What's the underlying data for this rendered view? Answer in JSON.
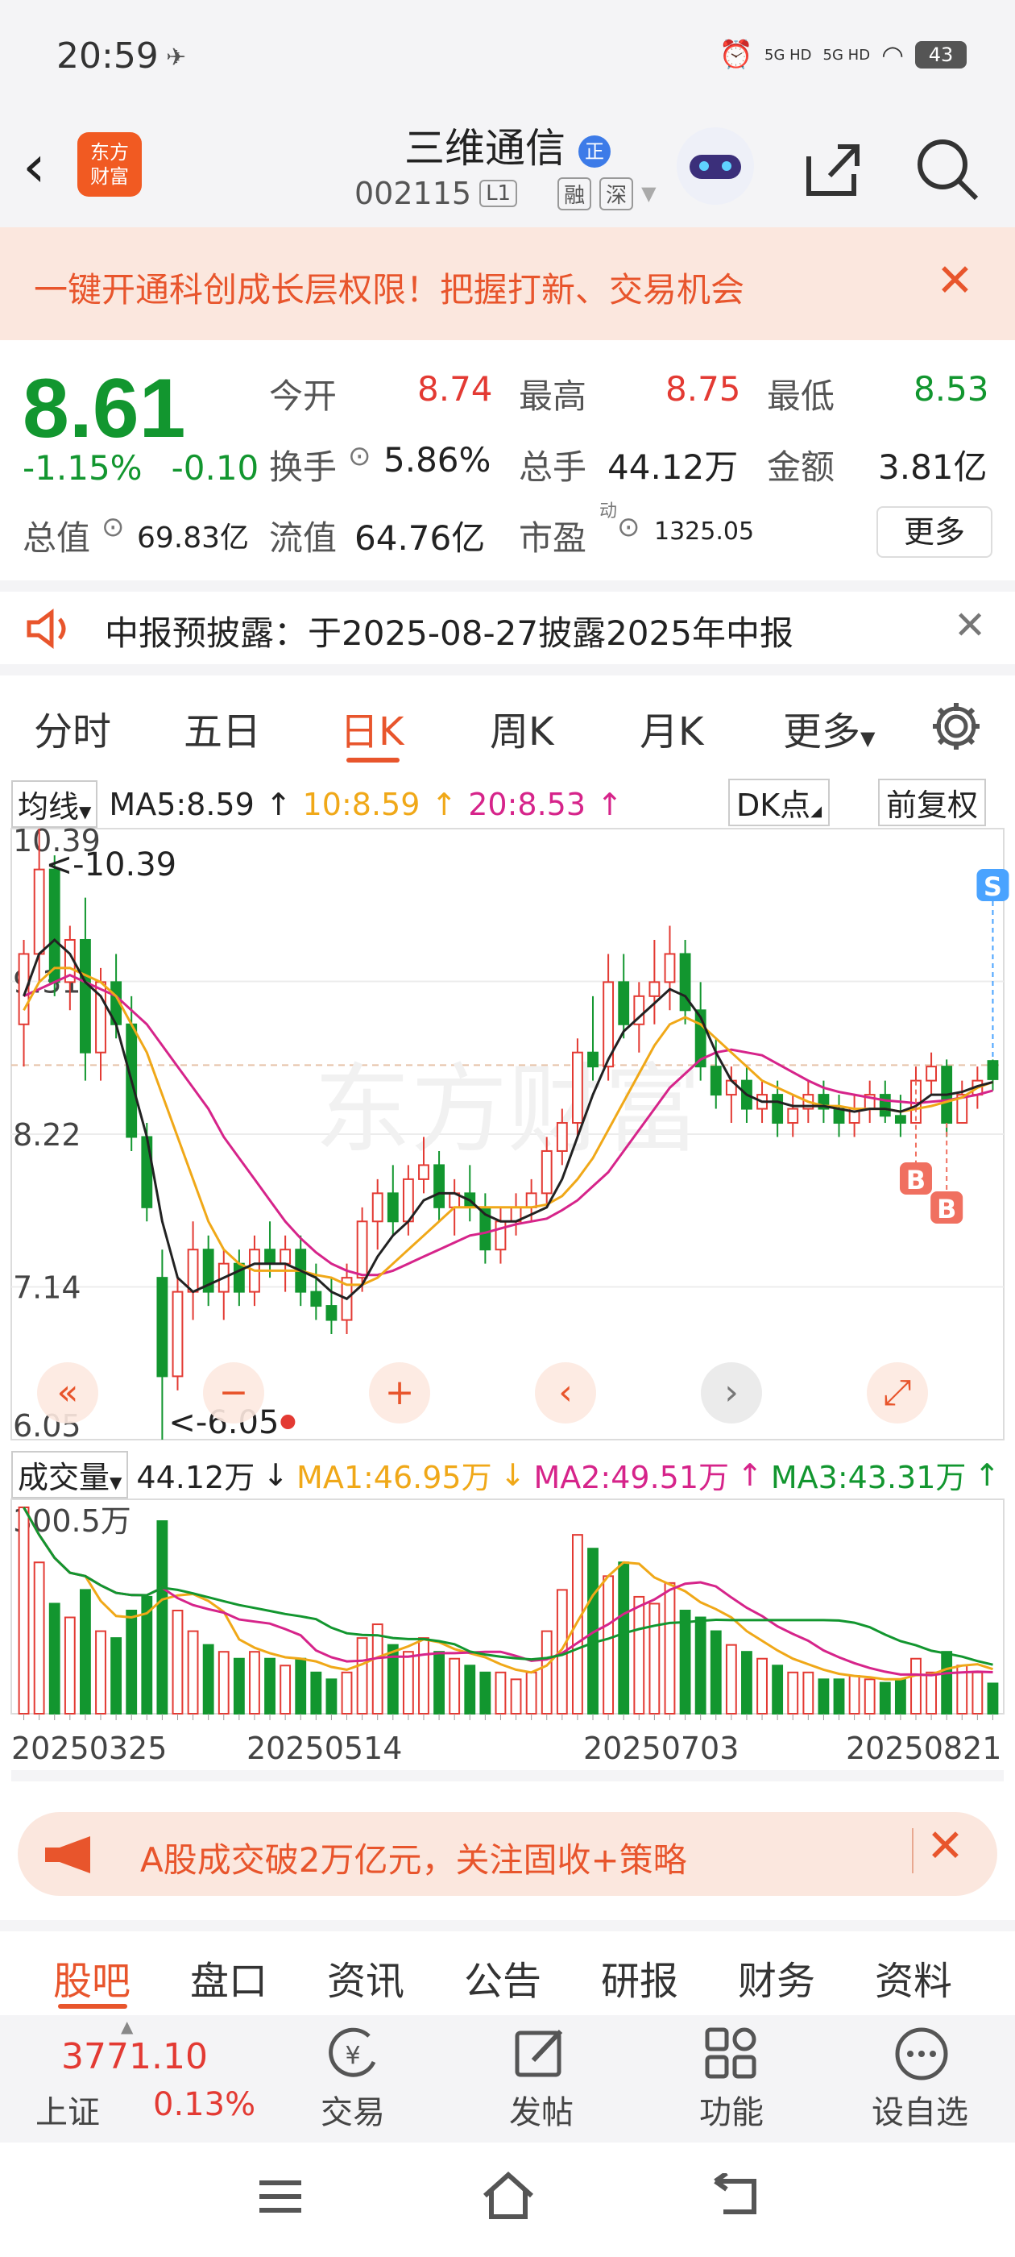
{
  "status": {
    "time": "20:59",
    "battery": "43",
    "net1": "5G HD",
    "net2": "5G HD"
  },
  "header": {
    "title": "三维通信",
    "title_badge": "正",
    "logo": "东方\n财富",
    "code": "002115",
    "level": "L1",
    "tag1": "融",
    "tag2": "深"
  },
  "promo": {
    "text": "一键开通科创成长层权限！把握打新、交易机会"
  },
  "quote": {
    "price": "8.61",
    "change_pct": "-1.15%",
    "change": "-0.10",
    "open_label": "今开",
    "open": "8.74",
    "high_label": "最高",
    "high": "8.75",
    "low_label": "最低",
    "low": "8.53",
    "turnover_label": "换手",
    "turnover": "5.86%",
    "volume_label": "总手",
    "volume": "44.12万",
    "amount_label": "金额",
    "amount": "3.81亿",
    "mcap_label": "总值",
    "mcap": "69.83亿",
    "float_label": "流值",
    "float": "64.76亿",
    "pe_label": "市盈",
    "pe_sup": "动",
    "pe": "1325.05",
    "more": "更多"
  },
  "notice": {
    "text": "中报预披露：于2025-08-27披露2025年中报"
  },
  "period_tabs": [
    "分时",
    "五日",
    "日K",
    "周K",
    "月K",
    "更多"
  ],
  "ma_bar": {
    "selector": "均线",
    "ma5": "MA5:8.59",
    "ma10": "10:8.59",
    "ma20": "20:8.53",
    "dk": "DK点",
    "adjust": "前复权",
    "ma_color5": "#222222",
    "ma_color10": "#f0a818",
    "ma_color20": "#d6248a"
  },
  "vol_bar": {
    "selector": "成交量",
    "vol": "44.12万",
    "ma1": "MA1:46.95万",
    "ma2": "MA2:49.51万",
    "ma3": "MA3:43.31万"
  },
  "chart_data": {
    "type": "candlestick",
    "price_axis": {
      "top": "10.39",
      "upper": "9.31",
      "mid": "8.22",
      "lower": "7.14",
      "bottom": "6.05",
      "ylim": [
        6.05,
        10.39
      ]
    },
    "annotations": {
      "max": "<-10.39",
      "min": "<-6.05",
      "sell": "S",
      "buy": "B"
    },
    "volume_axis": {
      "top": "300.5万"
    },
    "x_labels": [
      "20250325",
      "20250514",
      "20250703",
      "20250821"
    ],
    "candles": [
      [
        9.0,
        9.6,
        8.7,
        9.5
      ],
      [
        9.5,
        10.39,
        9.3,
        10.1
      ],
      [
        10.1,
        10.2,
        9.2,
        9.3
      ],
      [
        9.3,
        9.7,
        9.1,
        9.6
      ],
      [
        9.6,
        9.9,
        8.6,
        8.8
      ],
      [
        8.8,
        9.4,
        8.6,
        9.3
      ],
      [
        9.3,
        9.5,
        8.9,
        9.0
      ],
      [
        9.0,
        9.2,
        8.1,
        8.2
      ],
      [
        8.2,
        8.3,
        7.6,
        7.7
      ],
      [
        7.2,
        7.4,
        6.05,
        6.5
      ],
      [
        6.5,
        7.2,
        6.4,
        7.1
      ],
      [
        7.1,
        7.6,
        6.9,
        7.4
      ],
      [
        7.4,
        7.5,
        7.0,
        7.1
      ],
      [
        7.1,
        7.4,
        6.9,
        7.3
      ],
      [
        7.3,
        7.4,
        7.0,
        7.1
      ],
      [
        7.1,
        7.5,
        7.0,
        7.4
      ],
      [
        7.4,
        7.6,
        7.2,
        7.3
      ],
      [
        7.3,
        7.5,
        7.1,
        7.4
      ],
      [
        7.4,
        7.5,
        7.0,
        7.1
      ],
      [
        7.1,
        7.3,
        6.9,
        7.0
      ],
      [
        7.0,
        7.2,
        6.8,
        6.9
      ],
      [
        6.9,
        7.3,
        6.8,
        7.2
      ],
      [
        7.2,
        7.7,
        7.1,
        7.6
      ],
      [
        7.6,
        7.9,
        7.4,
        7.8
      ],
      [
        7.8,
        8.0,
        7.5,
        7.6
      ],
      [
        7.6,
        8.0,
        7.5,
        7.9
      ],
      [
        7.9,
        8.2,
        7.8,
        8.0
      ],
      [
        8.0,
        8.1,
        7.6,
        7.7
      ],
      [
        7.7,
        7.9,
        7.5,
        7.8
      ],
      [
        7.8,
        8.0,
        7.6,
        7.7
      ],
      [
        7.7,
        7.8,
        7.3,
        7.4
      ],
      [
        7.4,
        7.7,
        7.3,
        7.6
      ],
      [
        7.6,
        7.8,
        7.5,
        7.7
      ],
      [
        7.7,
        7.9,
        7.6,
        7.8
      ],
      [
        7.8,
        8.2,
        7.7,
        8.1
      ],
      [
        8.1,
        8.4,
        8.0,
        8.3
      ],
      [
        8.3,
        8.9,
        8.2,
        8.8
      ],
      [
        8.8,
        9.2,
        8.6,
        8.7
      ],
      [
        8.7,
        9.5,
        8.6,
        9.3
      ],
      [
        9.3,
        9.5,
        8.9,
        9.0
      ],
      [
        9.0,
        9.3,
        8.8,
        9.2
      ],
      [
        9.2,
        9.6,
        9.0,
        9.3
      ],
      [
        9.3,
        9.7,
        9.1,
        9.5
      ],
      [
        9.5,
        9.6,
        9.0,
        9.1
      ],
      [
        9.1,
        9.3,
        8.6,
        8.7
      ],
      [
        8.7,
        8.9,
        8.4,
        8.5
      ],
      [
        8.5,
        8.7,
        8.3,
        8.6
      ],
      [
        8.6,
        8.7,
        8.3,
        8.4
      ],
      [
        8.4,
        8.6,
        8.3,
        8.5
      ],
      [
        8.5,
        8.6,
        8.2,
        8.3
      ],
      [
        8.3,
        8.5,
        8.2,
        8.4
      ],
      [
        8.4,
        8.6,
        8.3,
        8.5
      ],
      [
        8.5,
        8.6,
        8.3,
        8.4
      ],
      [
        8.4,
        8.5,
        8.2,
        8.3
      ],
      [
        8.3,
        8.5,
        8.2,
        8.4
      ],
      [
        8.4,
        8.6,
        8.3,
        8.5
      ],
      [
        8.5,
        8.6,
        8.3,
        8.35
      ],
      [
        8.35,
        8.5,
        8.2,
        8.3
      ],
      [
        8.3,
        8.7,
        8.3,
        8.6
      ],
      [
        8.6,
        8.8,
        8.5,
        8.7
      ],
      [
        8.7,
        8.75,
        8.2,
        8.3
      ],
      [
        8.3,
        8.6,
        8.3,
        8.5
      ],
      [
        8.5,
        8.7,
        8.4,
        8.6
      ],
      [
        8.74,
        8.75,
        8.53,
        8.61
      ]
    ],
    "volume": [
      300,
      220,
      160,
      140,
      180,
      120,
      110,
      150,
      170,
      280,
      150,
      120,
      100,
      90,
      80,
      90,
      80,
      70,
      80,
      60,
      50,
      60,
      110,
      130,
      100,
      90,
      110,
      90,
      80,
      70,
      60,
      60,
      50,
      60,
      120,
      180,
      260,
      240,
      200,
      220,
      170,
      160,
      190,
      150,
      140,
      120,
      100,
      90,
      80,
      70,
      60,
      60,
      50,
      50,
      55,
      50,
      45,
      50,
      80,
      60,
      90,
      70,
      60,
      44
    ],
    "ma5": [
      9.2,
      9.5,
      9.6,
      9.5,
      9.3,
      9.2,
      9.0,
      8.6,
      8.2,
      7.6,
      7.2,
      7.1,
      7.15,
      7.2,
      7.25,
      7.3,
      7.3,
      7.3,
      7.25,
      7.2,
      7.1,
      7.05,
      7.15,
      7.35,
      7.5,
      7.6,
      7.75,
      7.8,
      7.8,
      7.75,
      7.65,
      7.6,
      7.6,
      7.65,
      7.7,
      7.9,
      8.2,
      8.5,
      8.75,
      8.95,
      9.05,
      9.15,
      9.25,
      9.2,
      9.05,
      8.8,
      8.6,
      8.5,
      8.45,
      8.45,
      8.42,
      8.42,
      8.42,
      8.4,
      8.38,
      8.4,
      8.4,
      8.38,
      8.42,
      8.5,
      8.5,
      8.52,
      8.56,
      8.59
    ],
    "ma10": [
      9.1,
      9.3,
      9.4,
      9.4,
      9.35,
      9.3,
      9.2,
      9.0,
      8.8,
      8.5,
      8.2,
      7.9,
      7.6,
      7.4,
      7.3,
      7.25,
      7.25,
      7.25,
      7.25,
      7.22,
      7.2,
      7.15,
      7.15,
      7.2,
      7.3,
      7.4,
      7.5,
      7.6,
      7.7,
      7.7,
      7.7,
      7.7,
      7.7,
      7.7,
      7.72,
      7.78,
      7.9,
      8.05,
      8.25,
      8.45,
      8.65,
      8.85,
      9.0,
      9.05,
      9.0,
      8.9,
      8.8,
      8.7,
      8.6,
      8.55,
      8.5,
      8.45,
      8.42,
      8.42,
      8.4,
      8.4,
      8.4,
      8.38,
      8.4,
      8.42,
      8.45,
      8.48,
      8.55,
      8.59
    ],
    "ma20": [
      9.2,
      9.25,
      9.3,
      9.35,
      9.3,
      9.25,
      9.2,
      9.1,
      9.0,
      8.85,
      8.7,
      8.55,
      8.4,
      8.2,
      8.05,
      7.9,
      7.75,
      7.6,
      7.48,
      7.38,
      7.3,
      7.25,
      7.22,
      7.22,
      7.25,
      7.3,
      7.35,
      7.4,
      7.45,
      7.5,
      7.52,
      7.55,
      7.58,
      7.6,
      7.62,
      7.68,
      7.75,
      7.85,
      7.95,
      8.1,
      8.25,
      8.4,
      8.55,
      8.65,
      8.75,
      8.8,
      8.82,
      8.8,
      8.78,
      8.72,
      8.66,
      8.6,
      8.55,
      8.52,
      8.5,
      8.48,
      8.46,
      8.45,
      8.44,
      8.45,
      8.46,
      8.48,
      8.5,
      8.53
    ]
  },
  "ad": {
    "text": "A股成交破2万亿元，关注固收+策略"
  },
  "bottom_tabs": [
    "股吧",
    "盘口",
    "资讯",
    "公告",
    "研报",
    "财务",
    "资料"
  ],
  "dock": {
    "index_value": "3771.10",
    "index_name": "上证",
    "index_change": "0.13%",
    "items": [
      "交易",
      "发帖",
      "功能",
      "设自选"
    ]
  },
  "colors": {
    "accent": "#e8552c",
    "up": "#e33a33",
    "down": "#12962f"
  }
}
